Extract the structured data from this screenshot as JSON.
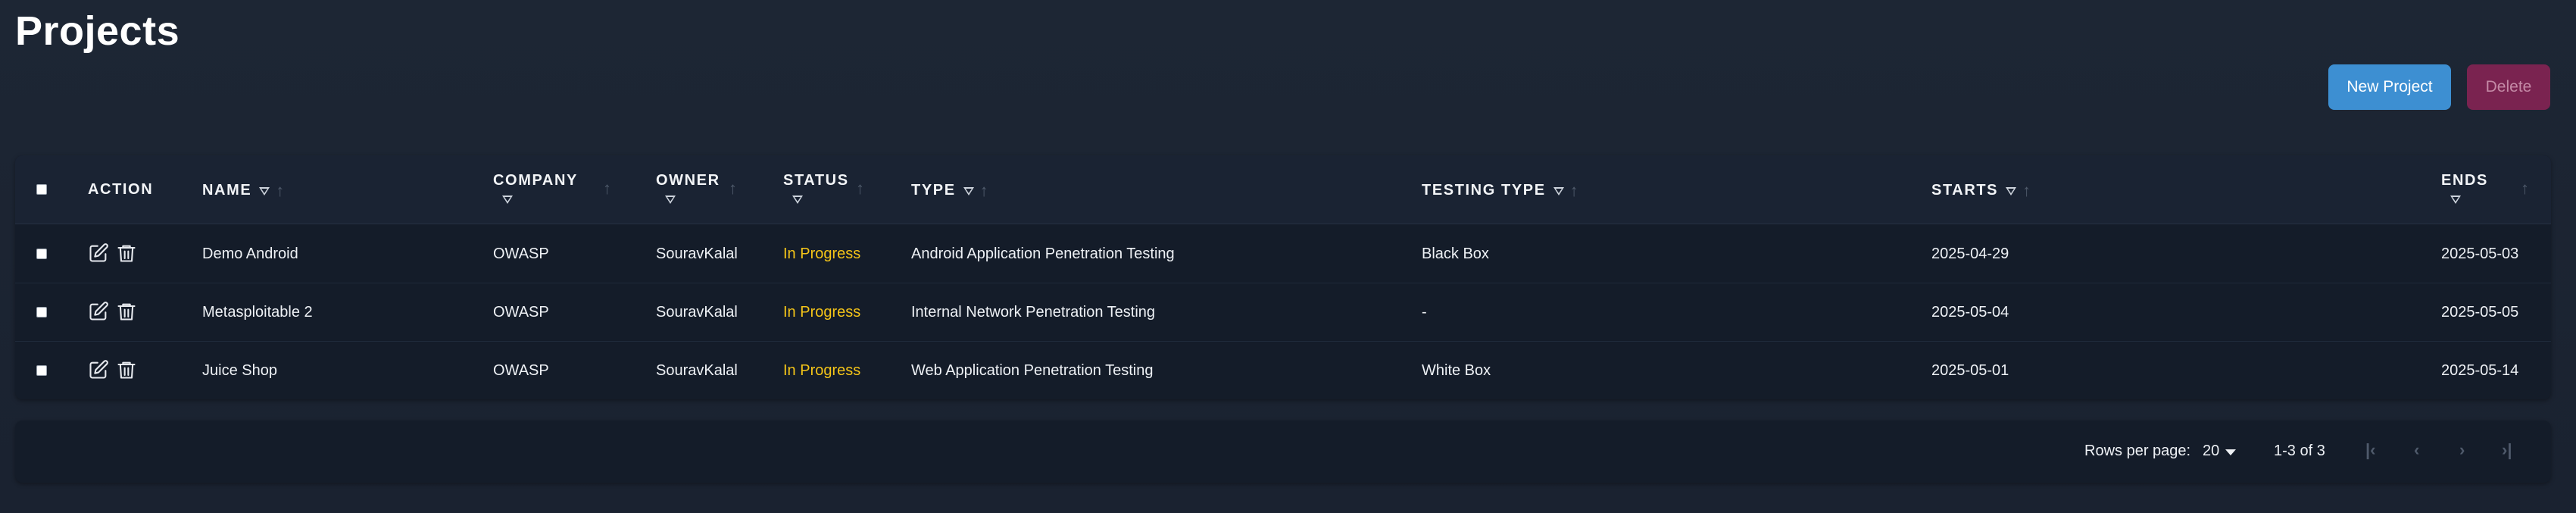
{
  "page": {
    "title": "Projects"
  },
  "toolbar": {
    "new_label": "New Project",
    "delete_label": "Delete"
  },
  "table": {
    "columns": {
      "action": "ACTION",
      "name": "NAME",
      "company": "COMPANY",
      "owner": "OWNER",
      "status": "STATUS",
      "type": "TYPE",
      "testing_type": "TESTING TYPE",
      "starts": "STARTS",
      "ends": "ENDS"
    },
    "rows": [
      {
        "name": "Demo Android",
        "company": "OWASP",
        "owner": "SouravKalal",
        "status": "In Progress",
        "type": "Android Application Penetration Testing",
        "testing_type": "Black Box",
        "starts": "2025-04-29",
        "ends": "2025-05-03"
      },
      {
        "name": "Metasploitable 2",
        "company": "OWASP",
        "owner": "SouravKalal",
        "status": "In Progress",
        "type": "Internal Network Penetration Testing",
        "testing_type": "-",
        "starts": "2025-05-04",
        "ends": "2025-05-05"
      },
      {
        "name": "Juice Shop",
        "company": "OWASP",
        "owner": "SouravKalal",
        "status": "In Progress",
        "type": "Web Application Penetration Testing",
        "testing_type": "White Box",
        "starts": "2025-05-01",
        "ends": "2025-05-14"
      }
    ]
  },
  "pagination": {
    "rows_per_page_label": "Rows per page:",
    "rows_per_page_value": "20",
    "range_text": "1-3 of 3"
  },
  "colors": {
    "background": "#1b2431",
    "card": "#141c29",
    "accent": "#3d8fd2",
    "delete": "#7a2350",
    "status_in_progress": "#f5c518"
  },
  "icons": [
    "edit-icon",
    "trash-icon",
    "filter-icon",
    "sort-arrow-icon",
    "first-page-icon",
    "prev-page-icon",
    "next-page-icon",
    "last-page-icon"
  ]
}
